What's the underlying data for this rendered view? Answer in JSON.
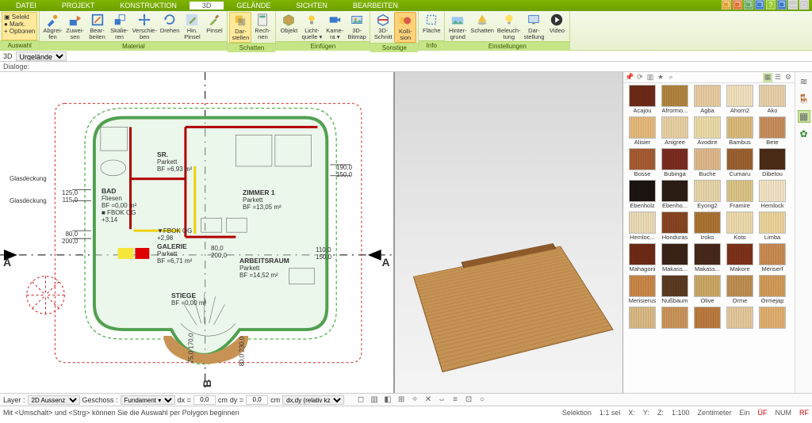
{
  "tabs": [
    "DATEI",
    "PROJEKT",
    "KONSTRUKTION",
    "3D",
    "GELÄNDE",
    "SICHTEN",
    "BEARBEITEN"
  ],
  "active_tab": "3D",
  "title_icons": [
    "❐",
    "❐",
    "❐",
    "❐",
    "?",
    "❐",
    "—",
    "□"
  ],
  "ribbon": {
    "groups": [
      {
        "label": "Auswahl",
        "buttons": [
          {
            "name": "selekt",
            "lines": [
              "▣ Selekt",
              "● Mark.",
              "+ Optionen"
            ],
            "special": "selekt"
          }
        ]
      },
      {
        "label": "Material",
        "buttons": [
          {
            "name": "abgreifen",
            "txt": "Abgrei-\nfen",
            "icon": "pick"
          },
          {
            "name": "zuweisen",
            "txt": "Zuwei-\nsen",
            "icon": "assign"
          },
          {
            "name": "bearbeiten",
            "txt": "Bear-\nbeiten",
            "icon": "edit"
          },
          {
            "name": "skalieren",
            "txt": "Skalie-\nren",
            "icon": "scale"
          },
          {
            "name": "verschieben",
            "txt": "Verschie-\nben",
            "icon": "move"
          },
          {
            "name": "drehen",
            "txt": "Drehen",
            "icon": "rotate"
          },
          {
            "name": "hin-pinsel",
            "txt": "Hin.\nPinsel",
            "icon": "brushbg"
          },
          {
            "name": "pinsel",
            "txt": "Pinsel",
            "icon": "brush"
          }
        ]
      },
      {
        "label": "Schatten",
        "buttons": [
          {
            "name": "darstellen",
            "txt": "Dar-\nstellen",
            "icon": "shadow",
            "sel": true
          },
          {
            "name": "rechnen",
            "txt": "Rech-\nnen",
            "icon": "calc"
          }
        ]
      },
      {
        "label": "Einfügen",
        "buttons": [
          {
            "name": "objekt",
            "txt": "Objekt",
            "icon": "object"
          },
          {
            "name": "lichtquelle",
            "txt": "Licht-\nquelle ▾",
            "icon": "light"
          },
          {
            "name": "kamera",
            "txt": "Kame-\nra ▾",
            "icon": "camera"
          },
          {
            "name": "3d-bitmap",
            "txt": "3D-\nBitmap",
            "icon": "bitmap"
          }
        ]
      },
      {
        "label": "Sonstige",
        "buttons": [
          {
            "name": "3d-schnitt",
            "txt": "3D-\nSchnitt",
            "icon": "cut"
          },
          {
            "name": "kollision",
            "txt": "Kolli-\nsion",
            "icon": "collide",
            "highlight": true
          }
        ]
      },
      {
        "label": "Info",
        "buttons": [
          {
            "name": "flaeche",
            "txt": "Fläche",
            "icon": "area"
          }
        ]
      },
      {
        "label": "Einstellungen",
        "buttons": [
          {
            "name": "hintergrund",
            "txt": "Hinter-\ngrund",
            "icon": "bg"
          },
          {
            "name": "schatten2",
            "txt": "Schatten",
            "icon": "shadow2"
          },
          {
            "name": "beleuchtung",
            "txt": "Beleuch-\ntung",
            "icon": "bulb"
          },
          {
            "name": "darstellung",
            "txt": "Dar-\nstellung",
            "icon": "display"
          },
          {
            "name": "video",
            "txt": "Video",
            "icon": "video"
          }
        ]
      }
    ]
  },
  "secondary": {
    "left": "3D",
    "dropdown": "Urgelände"
  },
  "dialog_label": "Dialoge:",
  "plan": {
    "left_labels": [
      "Glasdeckung",
      "Glasdeckung"
    ],
    "axis_label": "A",
    "axis_b": "B",
    "dims": {
      "d1": "125,0",
      "d2": "115,0",
      "d3": "80,0",
      "d4": "200,0",
      "d5": "80,0",
      "d6": "200,0",
      "d7": "110,0",
      "d8": "150,0",
      "d9": "190,0",
      "d10": "150,0",
      "d11": "75,0",
      "d12": "170,0",
      "d13": "80,0",
      "d14": "230,0",
      "d15": "15"
    },
    "rooms": {
      "bad": {
        "title": "BAD",
        "l2": "Fliesen",
        "l3": "BF =0,00 m²",
        "l4": "■ FBOK OG",
        "l5": "+3,14"
      },
      "sr": {
        "title": "SR.",
        "l2": "Parkett",
        "l3": "BF =6,93 m²"
      },
      "zimmer": {
        "title": "ZIMMER 1",
        "l2": "Parkett",
        "l3": "BF =13,05 m²"
      },
      "galerie": {
        "title": "GALERIE",
        "l2": "Parkett",
        "l3": "BF =6,71 m²",
        "tag": "▼FBOK OG",
        "tag2": "+2,98"
      },
      "arbeit": {
        "title": "ARBEITSRAUM",
        "l2": "Parkett",
        "l3": "BF =14,52 m²"
      },
      "stiege": {
        "title": "STIEGE",
        "l2": "BF =0,00 m²"
      }
    }
  },
  "materials": {
    "rows": [
      [
        {
          "n": "Acajou",
          "c": "#6b2a17"
        },
        {
          "n": "Afrormo...",
          "c": "#b0833f"
        },
        {
          "n": "Agba",
          "c": "#e6caa0"
        },
        {
          "n": "Ahorn2",
          "c": "#f1dfbd"
        },
        {
          "n": "Ako",
          "c": "#e6cfa8"
        }
      ],
      [
        {
          "n": "Alisier",
          "c": "#e4b87a"
        },
        {
          "n": "Anigree",
          "c": "#e7cfa2"
        },
        {
          "n": "Avodire",
          "c": "#ead9a6"
        },
        {
          "n": "Bambus",
          "c": "#d9b97a"
        },
        {
          "n": "Bete",
          "c": "#c68c5b"
        }
      ],
      [
        {
          "n": "Bosse",
          "c": "#a55b32"
        },
        {
          "n": "Bubinga",
          "c": "#7a2c20"
        },
        {
          "n": "Buche",
          "c": "#ddb68a"
        },
        {
          "n": "Cumaru",
          "c": "#9a6030"
        },
        {
          "n": "Dibetou",
          "c": "#4a2b16"
        }
      ],
      [
        {
          "n": "Ebenholz",
          "c": "#1b1410"
        },
        {
          "n": "Ebenho...",
          "c": "#2b1d14"
        },
        {
          "n": "Eyong2",
          "c": "#e5d4a7"
        },
        {
          "n": "Framire",
          "c": "#d9c285"
        },
        {
          "n": "Hemlock",
          "c": "#f0e2c2"
        }
      ],
      [
        {
          "n": "Hemloc...",
          "c": "#ead9b5"
        },
        {
          "n": "Honduras",
          "c": "#864421"
        },
        {
          "n": "Iroko",
          "c": "#a97333"
        },
        {
          "n": "Koto",
          "c": "#ecd9ab"
        },
        {
          "n": "Limba",
          "c": "#e9d39a"
        }
      ],
      [
        {
          "n": "Mahagoni",
          "c": "#6d2a16"
        },
        {
          "n": "Makass...",
          "c": "#3a2216"
        },
        {
          "n": "Makass...",
          "c": "#46281a"
        },
        {
          "n": "Makore",
          "c": "#7c3119"
        },
        {
          "n": "Meriserf",
          "c": "#c88a52"
        }
      ],
      [
        {
          "n": "Merisierus",
          "c": "#c88648"
        },
        {
          "n": "Nußbaum",
          "c": "#5b3a22"
        },
        {
          "n": "Olive",
          "c": "#caa664"
        },
        {
          "n": "Orme",
          "c": "#bd8d52"
        },
        {
          "n": "Ormejap",
          "c": "#d19a58"
        }
      ],
      [
        {
          "n": "",
          "c": "#d8b884"
        },
        {
          "n": "",
          "c": "#c9935a"
        },
        {
          "n": "",
          "c": "#ba7a3e"
        },
        {
          "n": "",
          "c": "#e2c79a"
        },
        {
          "n": "",
          "c": "#dfae6e"
        }
      ]
    ]
  },
  "bottom": {
    "layer_label": "Layer :",
    "layer_value": "2D Aussenz",
    "geschoss_label": "Geschoss :",
    "geschoss_value": "Fundament ▾",
    "dx": "0,0",
    "dy": "0,0",
    "unit": "cm",
    "mode": "dx,dy (relativ kz",
    "dx_label": "dx =",
    "dy_label": "dy ="
  },
  "status": {
    "hint": "Mit <Umschalt> und <Strg> können Sie die Auswahl per Polygon beginnen",
    "sel": "Selektion",
    "scale": "1:1 sel",
    "x": "X:",
    "y": "Y:",
    "z": "Z:",
    "scale2": "1:100",
    "unit": "Zentimeter",
    "ein": "Ein",
    "uf": "ÜF",
    "num": "NUM",
    "rf": "RF"
  }
}
